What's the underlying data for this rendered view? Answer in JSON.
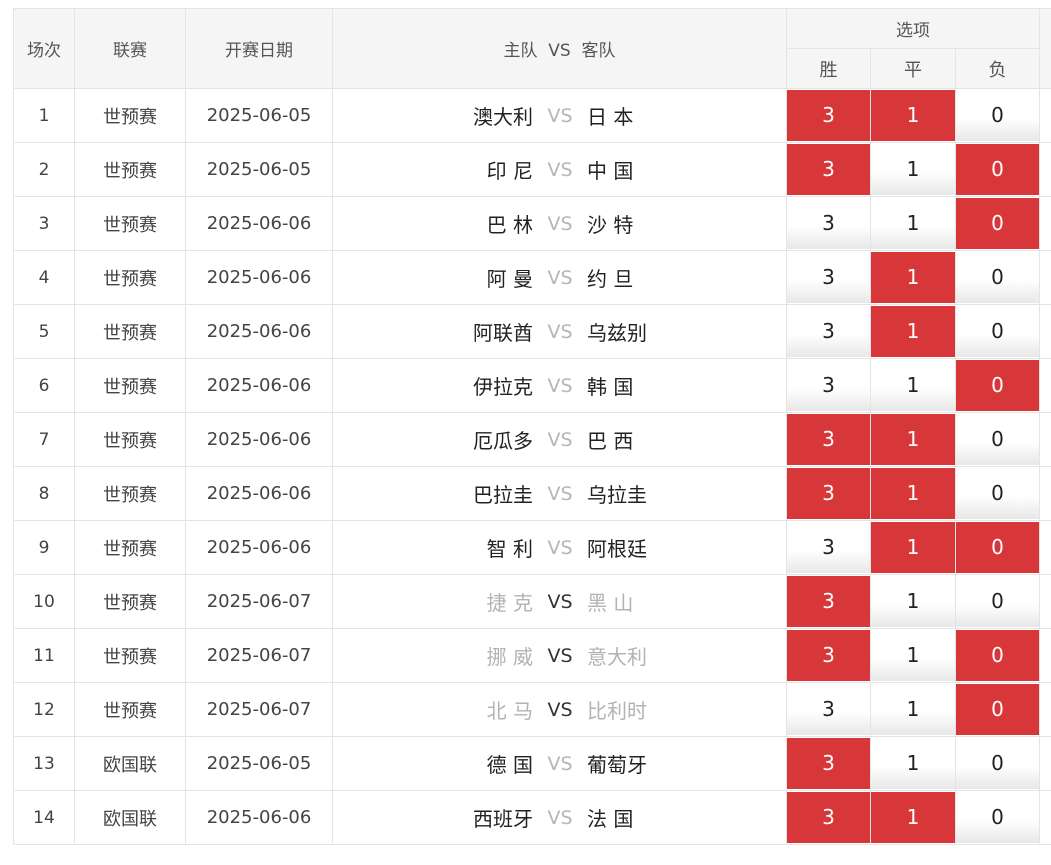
{
  "header": {
    "col_index": "场次",
    "col_league": "联赛",
    "col_date": "开赛日期",
    "col_home": "主队",
    "col_vs": "VS",
    "col_away": "客队",
    "col_options": "选项",
    "opt_win": "胜",
    "opt_draw": "平",
    "opt_lose": "负"
  },
  "rows": [
    {
      "idx": "1",
      "league": "世预赛",
      "date": "2025-06-05",
      "home": "澳大利",
      "vs": "VS",
      "away": "日 本",
      "win": "3",
      "draw": "1",
      "lose": "0",
      "win_on": true,
      "draw_on": true,
      "lose_on": false,
      "dim": false
    },
    {
      "idx": "2",
      "league": "世预赛",
      "date": "2025-06-05",
      "home": "印 尼",
      "vs": "VS",
      "away": "中 国",
      "win": "3",
      "draw": "1",
      "lose": "0",
      "win_on": true,
      "draw_on": false,
      "lose_on": true,
      "dim": false
    },
    {
      "idx": "3",
      "league": "世预赛",
      "date": "2025-06-06",
      "home": "巴 林",
      "vs": "VS",
      "away": "沙 特",
      "win": "3",
      "draw": "1",
      "lose": "0",
      "win_on": false,
      "draw_on": false,
      "lose_on": true,
      "dim": false
    },
    {
      "idx": "4",
      "league": "世预赛",
      "date": "2025-06-06",
      "home": "阿 曼",
      "vs": "VS",
      "away": "约 旦",
      "win": "3",
      "draw": "1",
      "lose": "0",
      "win_on": false,
      "draw_on": true,
      "lose_on": false,
      "dim": false
    },
    {
      "idx": "5",
      "league": "世预赛",
      "date": "2025-06-06",
      "home": "阿联酋",
      "vs": "VS",
      "away": "乌兹别",
      "win": "3",
      "draw": "1",
      "lose": "0",
      "win_on": false,
      "draw_on": true,
      "lose_on": false,
      "dim": false
    },
    {
      "idx": "6",
      "league": "世预赛",
      "date": "2025-06-06",
      "home": "伊拉克",
      "vs": "VS",
      "away": "韩 国",
      "win": "3",
      "draw": "1",
      "lose": "0",
      "win_on": false,
      "draw_on": false,
      "lose_on": true,
      "dim": false
    },
    {
      "idx": "7",
      "league": "世预赛",
      "date": "2025-06-06",
      "home": "厄瓜多",
      "vs": "VS",
      "away": "巴 西",
      "win": "3",
      "draw": "1",
      "lose": "0",
      "win_on": true,
      "draw_on": true,
      "lose_on": false,
      "dim": false
    },
    {
      "idx": "8",
      "league": "世预赛",
      "date": "2025-06-06",
      "home": "巴拉圭",
      "vs": "VS",
      "away": "乌拉圭",
      "win": "3",
      "draw": "1",
      "lose": "0",
      "win_on": true,
      "draw_on": true,
      "lose_on": false,
      "dim": false
    },
    {
      "idx": "9",
      "league": "世预赛",
      "date": "2025-06-06",
      "home": "智 利",
      "vs": "VS",
      "away": "阿根廷",
      "win": "3",
      "draw": "1",
      "lose": "0",
      "win_on": false,
      "draw_on": true,
      "lose_on": true,
      "dim": false
    },
    {
      "idx": "10",
      "league": "世预赛",
      "date": "2025-06-07",
      "home": "捷 克",
      "vs": "VS",
      "away": "黑 山",
      "win": "3",
      "draw": "1",
      "lose": "0",
      "win_on": true,
      "draw_on": false,
      "lose_on": false,
      "dim": true
    },
    {
      "idx": "11",
      "league": "世预赛",
      "date": "2025-06-07",
      "home": "挪 威",
      "vs": "VS",
      "away": "意大利",
      "win": "3",
      "draw": "1",
      "lose": "0",
      "win_on": true,
      "draw_on": false,
      "lose_on": true,
      "dim": true
    },
    {
      "idx": "12",
      "league": "世预赛",
      "date": "2025-06-07",
      "home": "北 马",
      "vs": "VS",
      "away": "比利时",
      "win": "3",
      "draw": "1",
      "lose": "0",
      "win_on": false,
      "draw_on": false,
      "lose_on": true,
      "dim": true
    },
    {
      "idx": "13",
      "league": "欧国联",
      "date": "2025-06-05",
      "home": "德 国",
      "vs": "VS",
      "away": "葡萄牙",
      "win": "3",
      "draw": "1",
      "lose": "0",
      "win_on": true,
      "draw_on": false,
      "lose_on": false,
      "dim": false
    },
    {
      "idx": "14",
      "league": "欧国联",
      "date": "2025-06-06",
      "home": "西班牙",
      "vs": "VS",
      "away": "法 国",
      "win": "3",
      "draw": "1",
      "lose": "0",
      "win_on": true,
      "draw_on": true,
      "lose_on": false,
      "dim": false
    }
  ],
  "colors": {
    "selected": "#d8373a",
    "header_bg": "#f5f5f5",
    "border": "#e4e4e4"
  }
}
